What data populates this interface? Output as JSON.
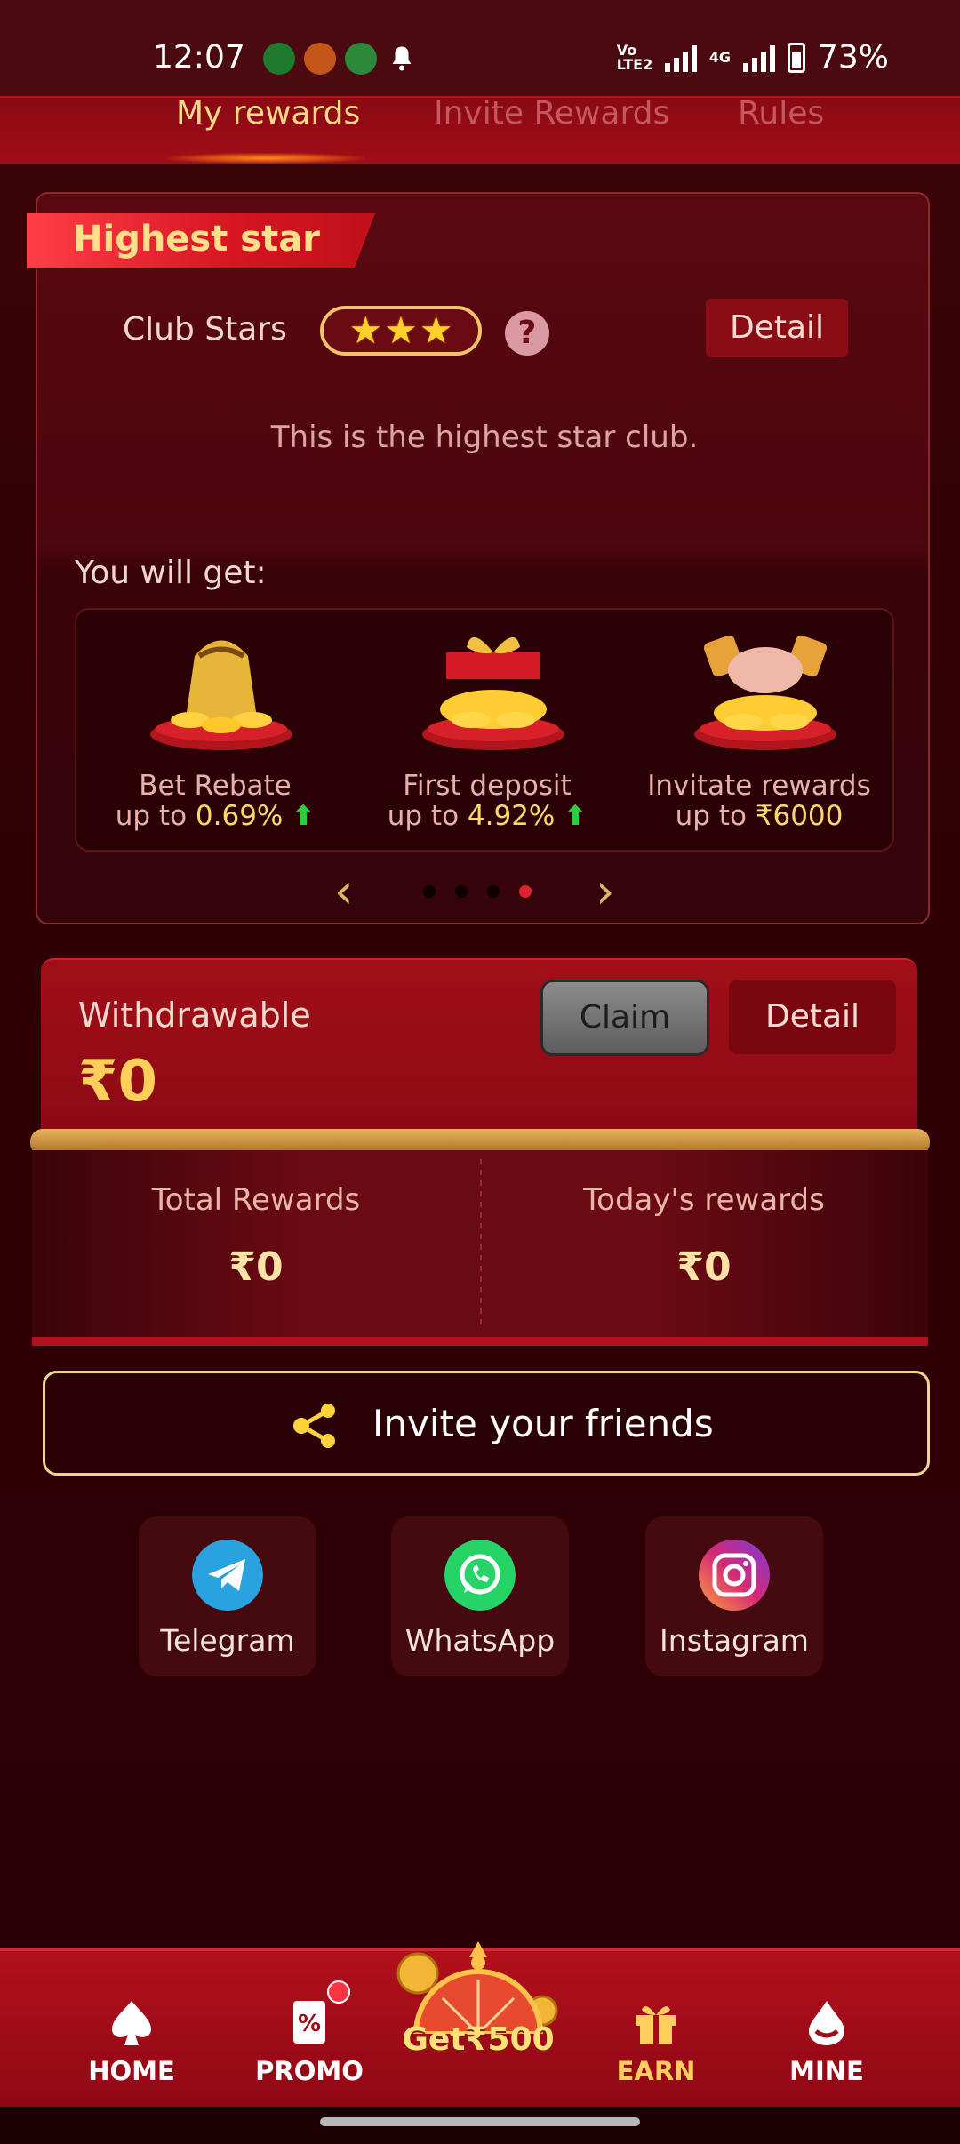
{
  "status_bar": {
    "time": "12:07",
    "battery": "73%",
    "network": "4G",
    "volte": "Vo LTE2"
  },
  "tabs": [
    {
      "label": "My rewards",
      "active": true
    },
    {
      "label": "Invite Rewards",
      "active": false
    },
    {
      "label": "Rules",
      "active": false
    }
  ],
  "star_card": {
    "ribbon_title": "Highest star",
    "club_label": "Club Stars",
    "stars": 3,
    "help": "?",
    "detail_label": "Detail",
    "message": "This is the highest star club.",
    "you_will_get": "You will get:",
    "rewards": [
      {
        "title": "Bet Rebate",
        "prefix": "up to ",
        "value": "0.69%",
        "trend": "up"
      },
      {
        "title": "First deposit",
        "prefix": "up to ",
        "value": "4.92%",
        "trend": "up"
      },
      {
        "title": "Invitate rewards",
        "prefix": "up to ",
        "value": "₹6000",
        "trend": ""
      }
    ],
    "carousel": {
      "pages": 4,
      "active_page": 4
    }
  },
  "withdrawable": {
    "label": "Withdrawable",
    "amount": "₹0",
    "claim_label": "Claim",
    "detail_label": "Detail"
  },
  "stats": {
    "total_label": "Total Rewards",
    "total_value": "₹0",
    "today_label": "Today's rewards",
    "today_value": "₹0"
  },
  "invite": {
    "label": "Invite your friends"
  },
  "social": [
    {
      "label": "Telegram",
      "color": "#2aa2e0"
    },
    {
      "label": "WhatsApp",
      "color": "#25d366"
    },
    {
      "label": "Instagram",
      "color": "#d62976"
    }
  ],
  "bottom_nav": {
    "items": [
      {
        "label": "HOME",
        "active": false
      },
      {
        "label": "PROMO",
        "active": false
      },
      {
        "label": "EARN",
        "active": true
      },
      {
        "label": "MINE",
        "active": false
      }
    ],
    "wheel_label": "Get₹500"
  },
  "colors": {
    "background": "#2f0105",
    "accent_gold": "#ffd86a",
    "tab_bar": "#a10d18",
    "nav_active": "#ffce5c"
  }
}
